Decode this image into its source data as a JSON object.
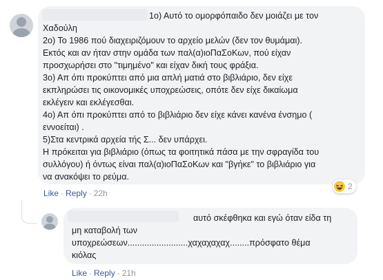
{
  "comment1": {
    "lines": [
      "1ο) Αυτό το ομορφόπαιδο δεν μοιάζει με τον",
      "Χαδούλη",
      "2ο) Το 1986 πού διαχειριζόμουν το αρχείο μελών (δεν τον θυμάμαι).",
      "Εκτός και αν ήταν στην ομάδα των παλ(α)ιοΠαΣοΚων, πού είχαν",
      "προσχωρήσει στο \"τιμημένο\" και είχαν δική τους φράξια.",
      "3ο) Απ όπι προκύπτει από μια απλή ματιά στο βιβλιάριο, δεν είχε",
      "εκπληρώσει τις οικονομικές υποχρεώσεις, οπότε δεν είχε δικαίωμα",
      "εκλέγειν και εκλέγεσθαι.",
      "4ο) Απ όπι προκύπτει από το βιβλιάριο δεν είχε κάνει κανένα ένσημο (",
      "εννοείται) .",
      "5)Στα κεντρικά αρχεία τής Σ... δεν υπάρχει.",
      "Η πρόκειται για βιβλιάριο (όπως τα φοιτητικά πάσα με την σφραγίδα του",
      "συλλόγου) ή όντως είναι παλ(α)ιοΠαΣοΚων και \"βγήκε\" το βιβλιάριο για",
      "να ανακόψει το ρεύμα."
    ],
    "like_label": "Like",
    "reply_label": "Reply",
    "separator": "·",
    "time": "22h",
    "reaction_icon": "haha-emoji-icon",
    "reaction_count": "2"
  },
  "comment2": {
    "lines": [
      "αυτό σκέφθηκα και εγώ όταν είδα τη",
      "μη καταβολή των",
      "υποχρεώσεων.........................χαχαχαχαχ........πρόσφατο θέμα",
      "κιόλας"
    ],
    "like_label": "Like",
    "reply_label": "Reply",
    "separator": "·",
    "time": "21h"
  },
  "colors": {
    "bubble": "#f2f3f5",
    "link": "#385898",
    "meta": "#90949c",
    "text": "#1c1e21"
  }
}
